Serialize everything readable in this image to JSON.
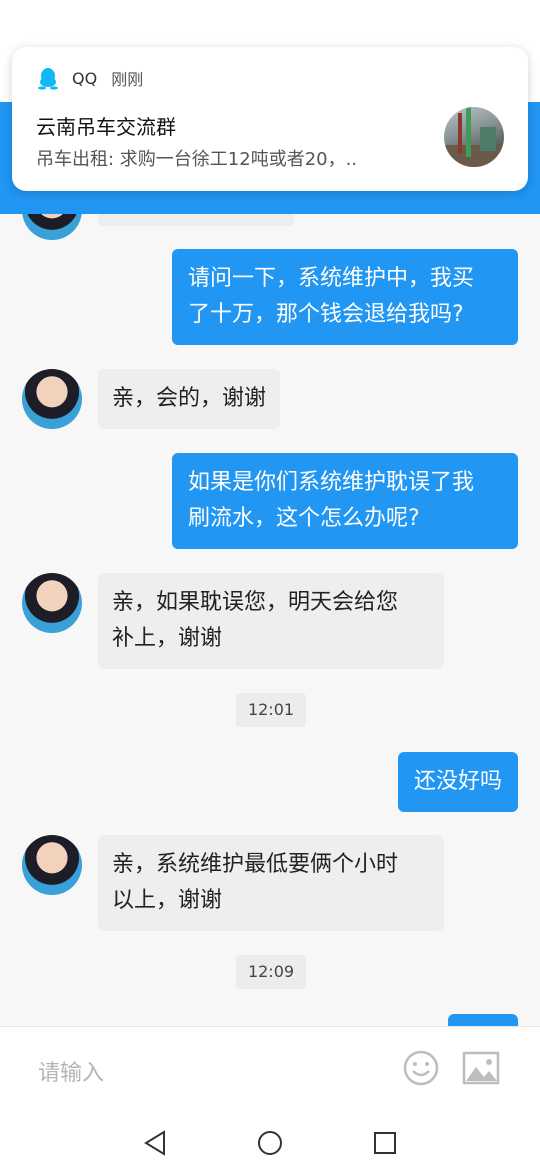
{
  "notification": {
    "app_name": "QQ",
    "time": "刚刚",
    "title": "云南吊车交流群",
    "body": "吊车出租: 求购一台徐工12吨或者20，..",
    "app_icon": "qq-penguin-icon",
    "thumbnail": "crane-photo"
  },
  "chat": {
    "messages": [
      {
        "side": "right",
        "text_lines": [
          "请问一下，系统维护中，我买",
          "了十万，那个钱会退给我吗?"
        ]
      },
      {
        "side": "left",
        "text_lines": [
          "亲，会的，谢谢"
        ]
      },
      {
        "side": "right",
        "text_lines": [
          "如果是你们系统维护耽误了我",
          "刷流水，这个怎么办呢?"
        ]
      },
      {
        "side": "left",
        "text_lines": [
          "亲，如果耽误您，明天会给您",
          "补上，谢谢"
        ]
      },
      {
        "side": "time",
        "text": "12:01"
      },
      {
        "side": "right",
        "text_lines": [
          "还没好吗"
        ]
      },
      {
        "side": "left",
        "text_lines": [
          "亲，系统维护最低要俩个小时",
          "以上，谢谢"
        ]
      },
      {
        "side": "time",
        "text": "12:09"
      }
    ]
  },
  "input": {
    "placeholder": "请输入",
    "emoji_icon": "smiley-icon",
    "image_icon": "image-icon"
  },
  "navbar": {
    "back_icon": "back-triangle-icon",
    "home_icon": "home-circle-icon",
    "recents_icon": "recents-square-icon"
  },
  "colors": {
    "accent": "#2196f3",
    "bubble_left": "#eeeeee",
    "background": "#f7f7f7"
  }
}
